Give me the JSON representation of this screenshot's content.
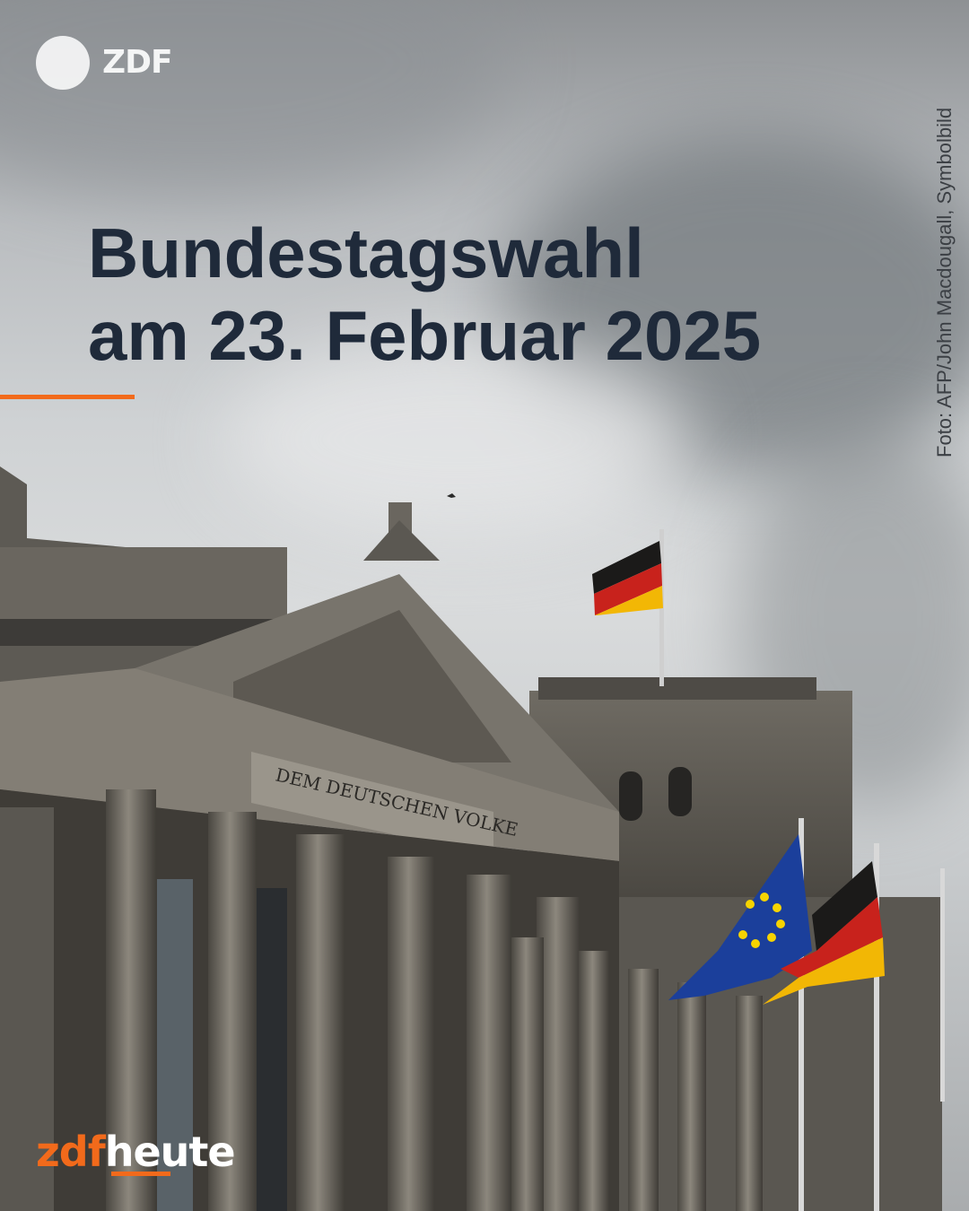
{
  "logo": {
    "brand": "ZDF",
    "sub_brand_part1": "zdf",
    "sub_brand_part2": "heute"
  },
  "headline": {
    "line1": "Bundestagswahl",
    "line2": "am 23. Februar 2025"
  },
  "photo": {
    "credit": "Foto: AFP/John Macdougall, Symbolbild",
    "inscription": "DEM DEUTSCHEN VOLKE"
  },
  "colors": {
    "accent": "#f26a1b",
    "headline": "#1f2a3a"
  }
}
